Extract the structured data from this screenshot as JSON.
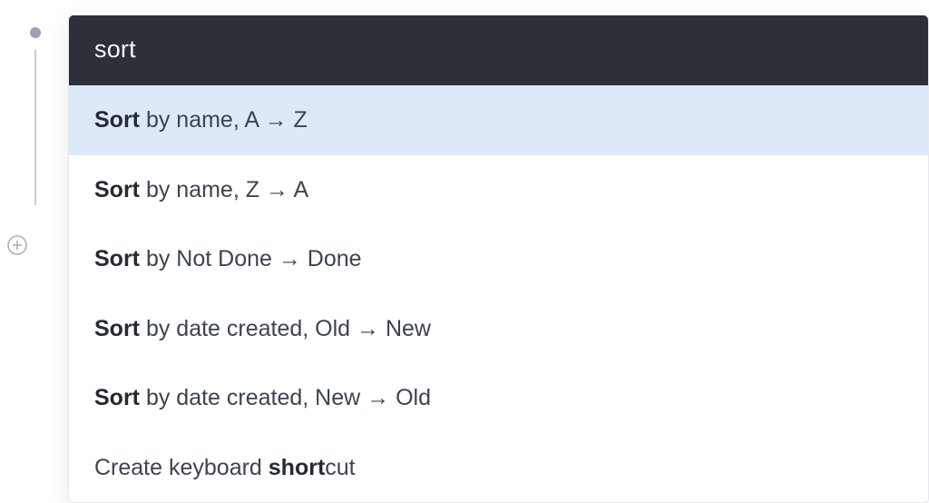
{
  "search": {
    "value": "sort",
    "placeholder": ""
  },
  "results": [
    {
      "prefix": "Sort",
      "rest": " by name, A → Z",
      "highlighted": true
    },
    {
      "prefix": "Sort",
      "rest": " by name, Z → A",
      "highlighted": false
    },
    {
      "prefix": "Sort",
      "rest": " by Not Done → Done",
      "highlighted": false
    },
    {
      "prefix": "Sort",
      "rest": " by date created, Old → New",
      "highlighted": false
    },
    {
      "prefix": "Sort",
      "rest": " by date created, New → Old",
      "highlighted": false
    },
    {
      "before": "Create keyboard ",
      "match": "short",
      "after": "cut",
      "highlighted": false
    }
  ]
}
